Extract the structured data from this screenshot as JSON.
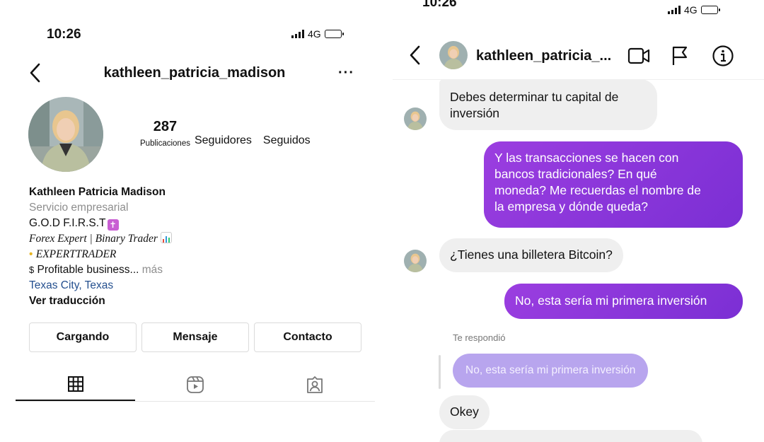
{
  "profile_screen": {
    "status_time": "10:26",
    "network": "4G",
    "username": "kathleen_patricia_madison",
    "stats": {
      "posts_count": "287",
      "posts_label": "Publicaciones",
      "followers_label": "Seguidores",
      "following_label": "Seguidos"
    },
    "bio": {
      "name": "Kathleen Patricia Madison",
      "category": "Servicio empresarial",
      "line1": "G.O.D F.I.R.S.T",
      "line2": "Forex Expert | Binary Trader",
      "line3": "EXPERTTRADER",
      "line4": "Profitable business...",
      "more": " más",
      "location": "Texas City, Texas",
      "translate": "Ver traducción"
    },
    "buttons": {
      "follow": "Cargando",
      "message": "Mensaje",
      "contact": "Contacto"
    },
    "tabs": [
      "grid-icon",
      "reels-icon",
      "tagged-icon"
    ]
  },
  "chat_screen": {
    "status_time": "10:26",
    "network": "4G",
    "contact_name": "kathleen_patricia_...",
    "messages": [
      {
        "from": "them",
        "text": "Debes determinar tu capital de\ninversión"
      },
      {
        "from": "me",
        "text": "Y las transacciones se hacen con\nbancos tradicionales? En qué\nmoneda? Me recuerdas el nombre de\nla empresa y dónde queda?"
      },
      {
        "from": "them",
        "text": "¿Tienes una billetera Bitcoin?"
      },
      {
        "from": "me",
        "text": "No, esta sería mi primera inversión"
      },
      {
        "from": "them",
        "text": "Okey"
      }
    ],
    "reply": {
      "label": "Te respondió",
      "quoted": "No, esta sería mi primera inversión"
    }
  },
  "colors": {
    "outgoing_bubble": "#8a35db",
    "incoming_bubble": "#efefef",
    "link": "#25508f",
    "secondary_text": "#8e8e8e"
  }
}
